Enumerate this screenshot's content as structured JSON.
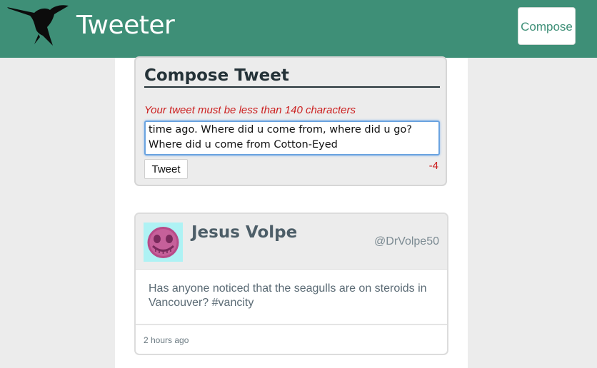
{
  "header": {
    "logo_icon": "hummingbird-icon",
    "title": "Tweeter",
    "compose_button_label": "Compose",
    "background_color": "#3e8f77"
  },
  "compose": {
    "heading": "Compose Tweet",
    "error_message": "Your tweet must be less than 140 characters",
    "textarea_value": "time ago. Where did u come from, where did u go? Where did u come from Cotton-Eyed",
    "tweet_button_label": "Tweet",
    "char_counter": "-4",
    "error_color": "#cc2020"
  },
  "tweet": {
    "avatar_icon": "smiley-face-avatar-icon",
    "name": "Jesus Volpe",
    "handle": "@DrVolpe50",
    "text": "Has anyone noticed that the seagulls are on steroids in Vancouver? #vancity",
    "timestamp": "2 hours ago"
  }
}
